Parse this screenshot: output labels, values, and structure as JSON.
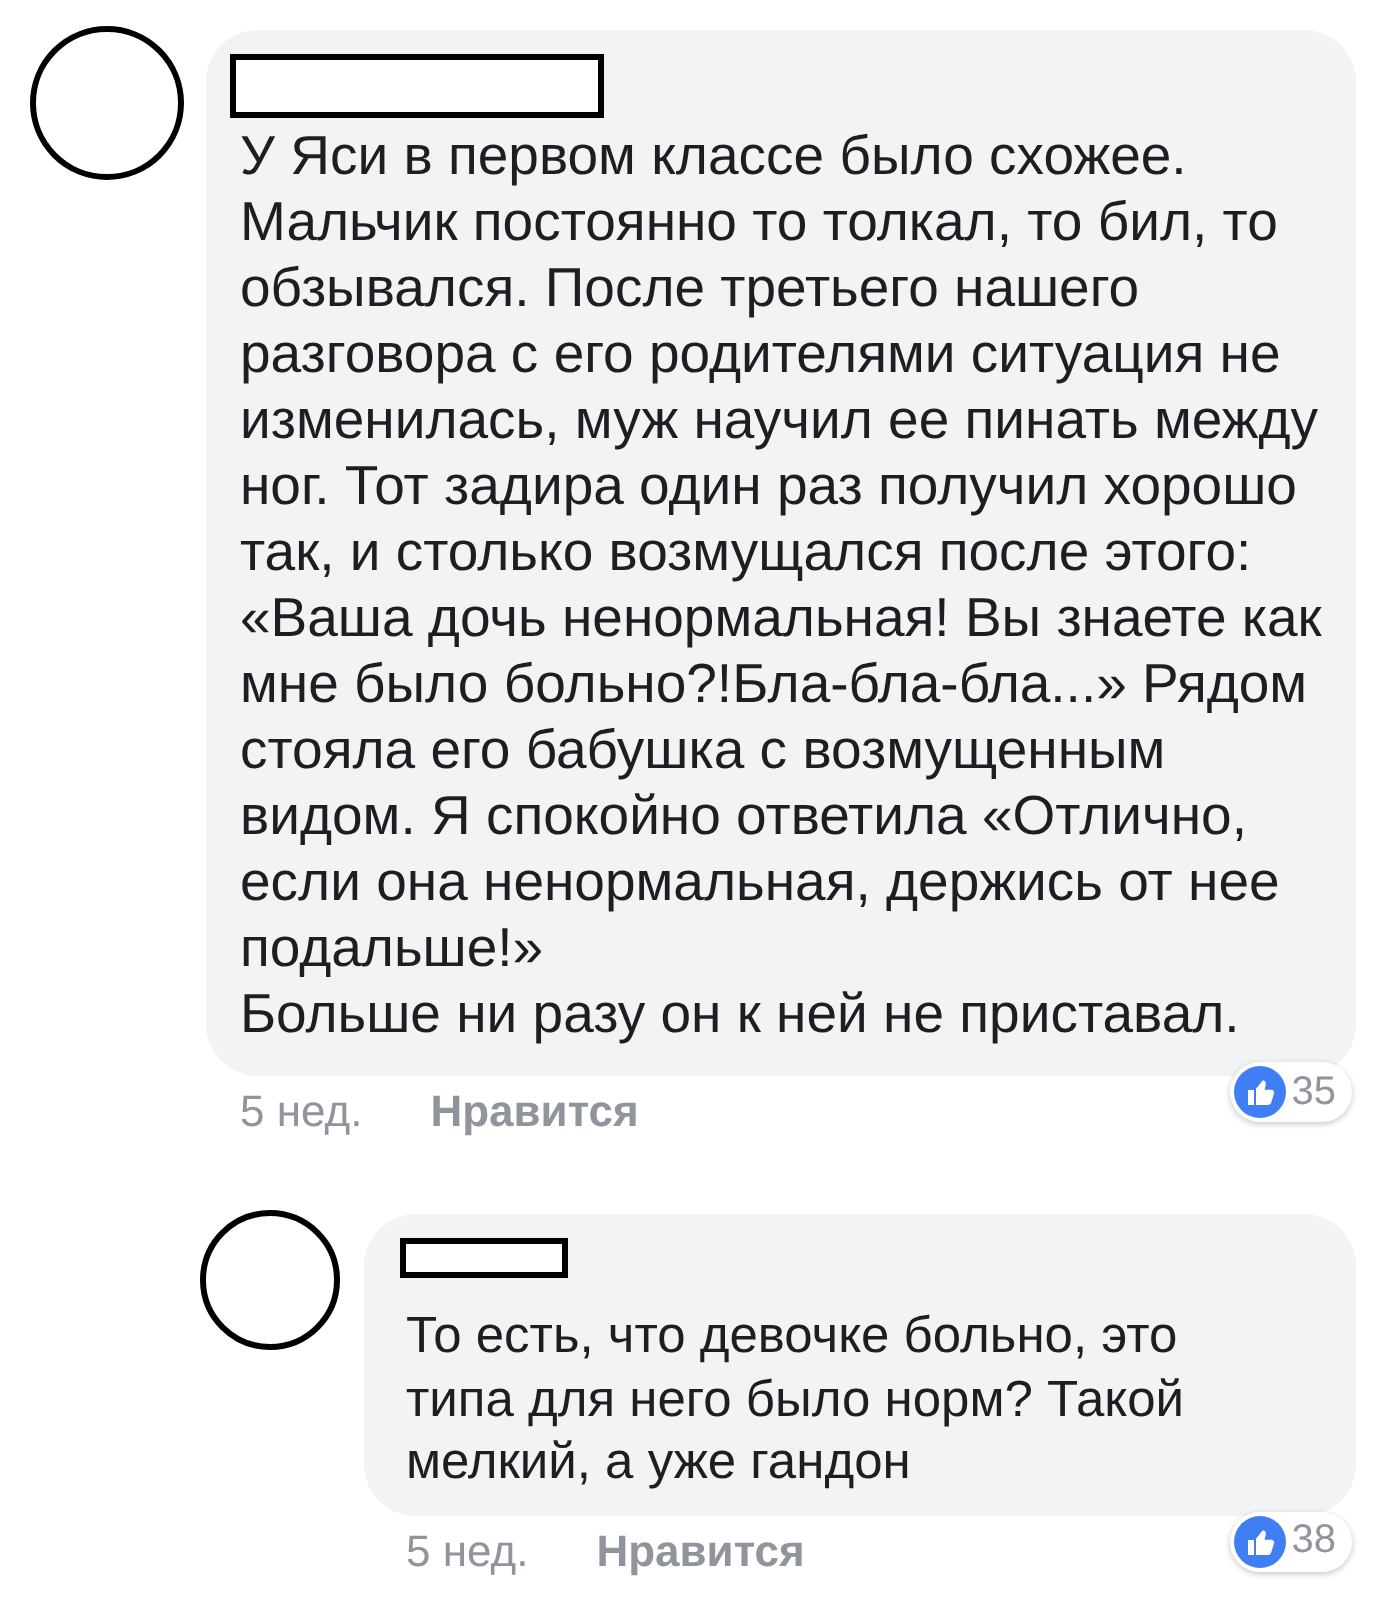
{
  "comments": [
    {
      "text": "У Яси в первом классе было схожее. Мальчик постоянно то толкал, то бил, то обзывался. После третьего нашего разговора с его родителями ситуация не изменилась, муж научил ее пинать между ног. Тот задира один раз получил хорошо так, и столько возмущался после этого: «Ваша дочь ненормальная! Вы знаете как мне было больно?!Бла-бла-бла...» Рядом стояла его бабушка с возмущенным видом. Я спокойно ответила «Отлично, если она ненормальная, держись от нее подальше!»\nБольше ни разу он к ней не приставал.",
      "time": "5 нед.",
      "like_label": "Нравится",
      "like_count": "35",
      "replies": [
        {
          "text": "То есть, что девочке больно, это типа для него было норм? Такой мелкий, а уже гандон",
          "time": "5 нед.",
          "like_label": "Нравится",
          "like_count": "38"
        }
      ]
    }
  ]
}
